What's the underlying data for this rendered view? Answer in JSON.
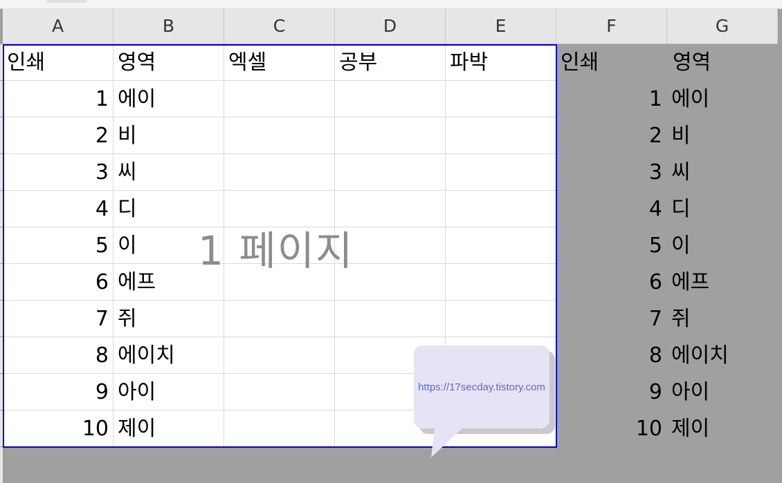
{
  "columns": [
    "A",
    "B",
    "C",
    "D",
    "E",
    "F",
    "G"
  ],
  "headers": {
    "A": "인쇄",
    "B": "영역",
    "C": "엑셀",
    "D": "공부",
    "E": "파박",
    "F": "인쇄",
    "G": "영역"
  },
  "rows": [
    {
      "num": "1",
      "label": "에이"
    },
    {
      "num": "2",
      "label": "비"
    },
    {
      "num": "3",
      "label": "씨"
    },
    {
      "num": "4",
      "label": "디"
    },
    {
      "num": "5",
      "label": "이"
    },
    {
      "num": "6",
      "label": "에프"
    },
    {
      "num": "7",
      "label": "쥐"
    },
    {
      "num": "8",
      "label": "에이치"
    },
    {
      "num": "9",
      "label": "아이"
    },
    {
      "num": "10",
      "label": "제이"
    }
  ],
  "watermark": "1 페이지",
  "callout": {
    "text": "https://17secday.tistory.com"
  },
  "colors": {
    "page_border": "#0000c8",
    "outside_print_area": "#a0a0a0",
    "callout_bg": "#e6e4f4",
    "callout_text": "#5b66d6"
  }
}
